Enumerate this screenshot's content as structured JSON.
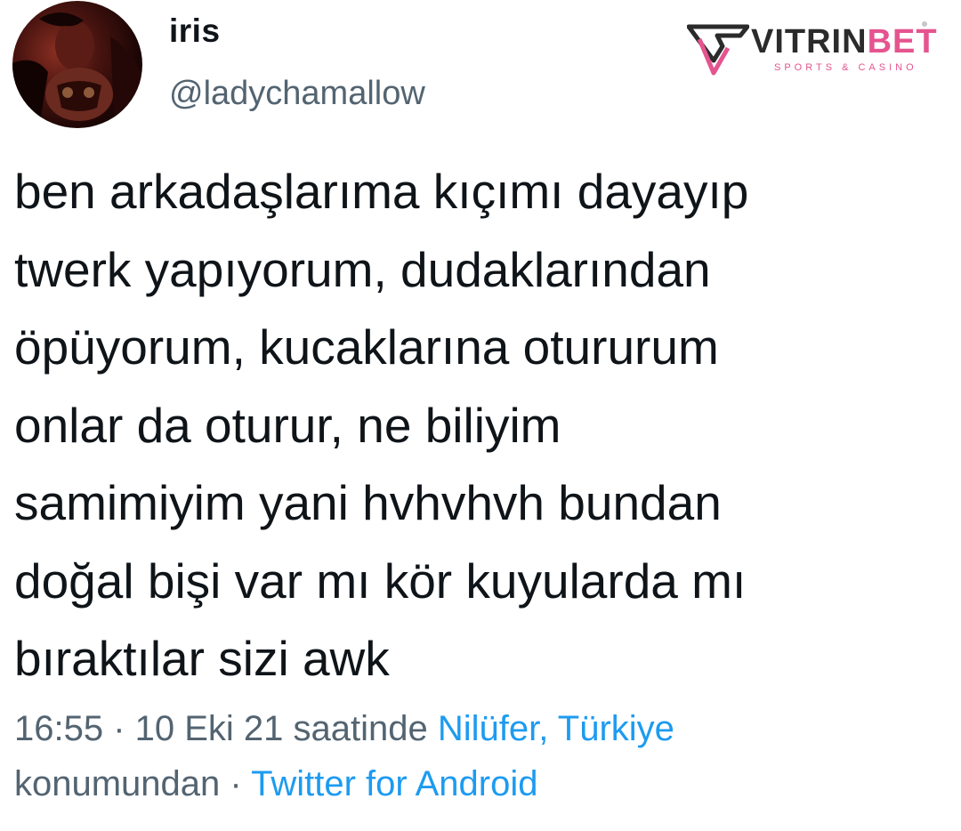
{
  "author": {
    "display_name": "iris",
    "handle": "@ladychamallow",
    "avatar_icon": "profile-photo"
  },
  "watermark": {
    "brand_part1": "VITRIN",
    "brand_part2": "BET",
    "tagline": "SPORTS & CASINO",
    "colors": {
      "dark": "#2b2b2b",
      "accent": "#e5548f"
    }
  },
  "tweet": {
    "lines": [
      "ben arkadaşlarıma kıçımı dayayıp",
      "twerk yapıyorum, dudaklarından",
      "öpüyorum, kucaklarına otururum",
      "onlar da oturur, ne biliyim",
      "samimiyim yani hvhvhvh bundan",
      "doğal bişi var mı kör kuyularda mı",
      "bıraktılar sizi awk"
    ]
  },
  "meta": {
    "time_date": "16:55 · 10 Eki 21 saatinde",
    "location": "Nilüfer, Türkiye",
    "location_suffix": "konumundan ·",
    "source": "Twitter for Android",
    "colors": {
      "muted": "#536471",
      "link": "#1d9bf0"
    }
  }
}
